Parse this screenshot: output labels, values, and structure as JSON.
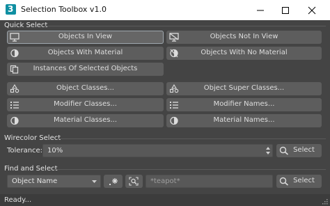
{
  "window": {
    "title": "Selection Toolbox v1.0",
    "app_glyph": "3"
  },
  "quick_select": {
    "label": "Quick Select",
    "buttons": [
      {
        "label": "Objects In View",
        "icon": "monitor-icon"
      },
      {
        "label": "Objects Not In View",
        "icon": "monitor-off-icon"
      },
      {
        "label": "Objects With Material",
        "icon": "half-circle-icon"
      },
      {
        "label": "Objects With No Material",
        "icon": "material-off-icon"
      },
      {
        "label": "Instances Of Selected Objects",
        "icon": "copy-icon"
      },
      {
        "label": "Object Classes...",
        "icon": "shapes-icon"
      },
      {
        "label": "Object Super Classes...",
        "icon": "shapes-icon"
      },
      {
        "label": "Modifier Classes...",
        "icon": "list-icon"
      },
      {
        "label": "Modifier Names...",
        "icon": "list-icon"
      },
      {
        "label": "Material Classes...",
        "icon": "half-circle-icon"
      },
      {
        "label": "Material Names...",
        "icon": "half-circle-icon"
      }
    ]
  },
  "wirecolor": {
    "label": "Wirecolor Select",
    "tolerance_label": "Tolerance:",
    "tolerance_value": "10%",
    "select_label": "Select"
  },
  "find": {
    "label": "Find and Select",
    "dropdown_value": "Object Name",
    "search_placeholder": "*teapot*",
    "select_label": "Select"
  },
  "status": {
    "text": "Ready..."
  },
  "colors": {
    "background": "#444444",
    "button": "#5d5d5d",
    "titlebar": "#ffffff",
    "app_icon": "#0f8fa2"
  }
}
